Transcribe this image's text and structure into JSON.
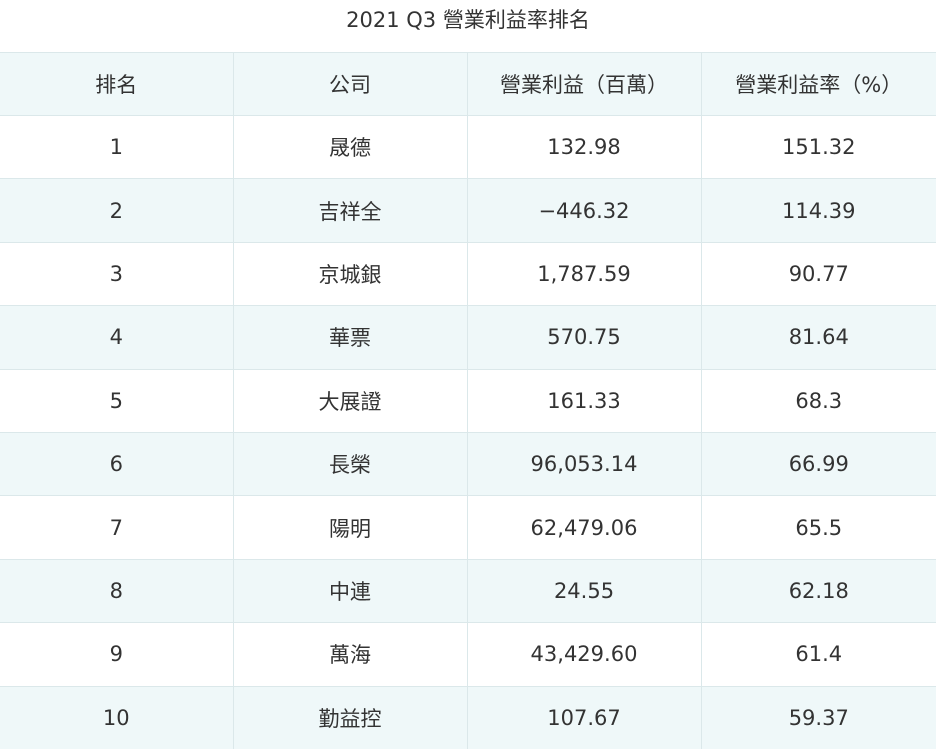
{
  "title": "2021 Q3 營業利益率排名",
  "columns": [
    "排名",
    "公司",
    "營業利益（百萬）",
    "營業利益率（%）"
  ],
  "rows": [
    {
      "rank": "1",
      "company": "晟德",
      "operating_income": "132.98",
      "operating_margin": "151.32"
    },
    {
      "rank": "2",
      "company": "吉祥全",
      "operating_income": "−446.32",
      "operating_margin": "114.39"
    },
    {
      "rank": "3",
      "company": "京城銀",
      "operating_income": "1,787.59",
      "operating_margin": "90.77"
    },
    {
      "rank": "4",
      "company": "華票",
      "operating_income": "570.75",
      "operating_margin": "81.64"
    },
    {
      "rank": "5",
      "company": "大展證",
      "operating_income": "161.33",
      "operating_margin": "68.3"
    },
    {
      "rank": "6",
      "company": "長榮",
      "operating_income": "96,053.14",
      "operating_margin": "66.99"
    },
    {
      "rank": "7",
      "company": "陽明",
      "operating_income": "62,479.06",
      "operating_margin": "65.5"
    },
    {
      "rank": "8",
      "company": "中連",
      "operating_income": "24.55",
      "operating_margin": "62.18"
    },
    {
      "rank": "9",
      "company": "萬海",
      "operating_income": "43,429.60",
      "operating_margin": "61.4"
    },
    {
      "rank": "10",
      "company": "勤益控",
      "operating_income": "107.67",
      "operating_margin": "59.37"
    }
  ]
}
